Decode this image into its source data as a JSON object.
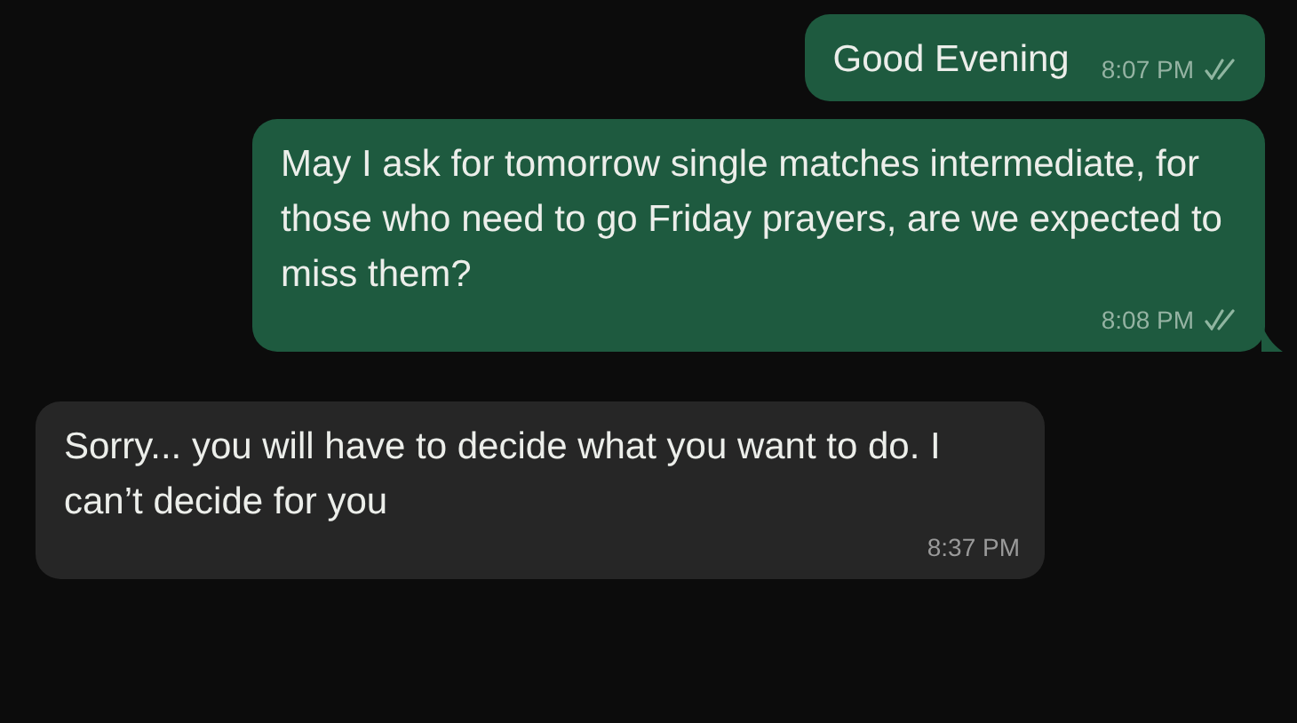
{
  "messages": [
    {
      "kind": "outgoing",
      "text": "Good Evening",
      "time": "8:07 PM",
      "read": true,
      "tail": false
    },
    {
      "kind": "outgoing",
      "text": "May I ask for tomorrow single matches intermediate, for those who need to go Friday prayers, are we expected to miss them?",
      "time": "8:08 PM",
      "read": true,
      "tail": true
    },
    {
      "kind": "incoming",
      "text": "Sorry... you will have to decide what you want to do. I can’t decide for you",
      "time": "8:37 PM",
      "tail": false
    }
  ]
}
